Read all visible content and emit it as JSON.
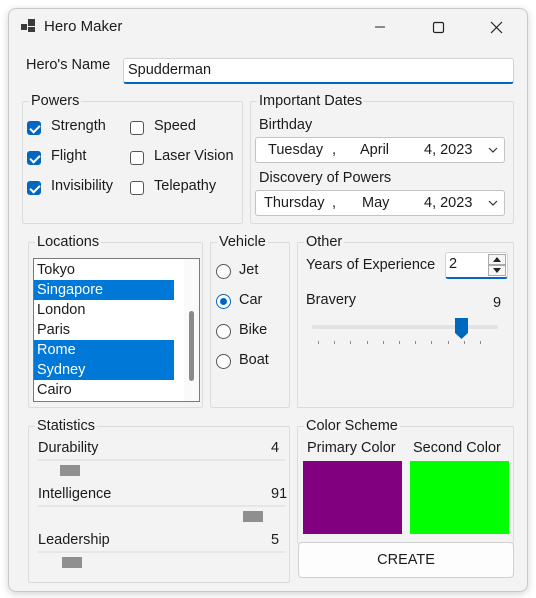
{
  "window": {
    "title": "Hero Maker"
  },
  "name_field": {
    "label": "Hero's Name",
    "value": "Spudderman"
  },
  "powers": {
    "title": "Powers",
    "items": [
      {
        "label": "Strength",
        "checked": true
      },
      {
        "label": "Speed",
        "checked": false
      },
      {
        "label": "Flight",
        "checked": true
      },
      {
        "label": "Laser Vision",
        "checked": false
      },
      {
        "label": "Invisibility",
        "checked": true
      },
      {
        "label": "Telepathy",
        "checked": false
      }
    ]
  },
  "dates": {
    "title": "Important Dates",
    "birthday": {
      "label": "Birthday",
      "weekday": "Tuesday",
      "month": "April",
      "day_year": "4, 2023"
    },
    "discovery": {
      "label": "Discovery of Powers",
      "weekday": "Thursday",
      "month": "May",
      "day_year": "4, 2023"
    }
  },
  "locations": {
    "title": "Locations",
    "items": [
      {
        "label": "Tokyo",
        "selected": false
      },
      {
        "label": "Singapore",
        "selected": true
      },
      {
        "label": "London",
        "selected": false
      },
      {
        "label": "Paris",
        "selected": false
      },
      {
        "label": "Rome",
        "selected": true
      },
      {
        "label": "Sydney",
        "selected": true
      },
      {
        "label": "Cairo",
        "selected": false
      }
    ]
  },
  "vehicle": {
    "title": "Vehicle",
    "options": [
      {
        "label": "Jet",
        "selected": false
      },
      {
        "label": "Car",
        "selected": true
      },
      {
        "label": "Bike",
        "selected": false
      },
      {
        "label": "Boat",
        "selected": false
      }
    ]
  },
  "other": {
    "title": "Other",
    "years_label": "Years of Experience",
    "years_value": "2",
    "bravery_label": "Bravery",
    "bravery_value": "9",
    "bravery_fraction": 0.9
  },
  "statistics": {
    "title": "Statistics",
    "items": [
      {
        "label": "Durability",
        "value": "4"
      },
      {
        "label": "Intelligence",
        "value": "91"
      },
      {
        "label": "Leadership",
        "value": "5"
      }
    ]
  },
  "colors": {
    "title": "Color Scheme",
    "primary_label": "Primary Color",
    "primary_color": "#800080",
    "second_label": "Second Color",
    "second_color": "#00ff00",
    "accent": "#0067c0"
  },
  "create_button": {
    "label": "CREATE"
  }
}
